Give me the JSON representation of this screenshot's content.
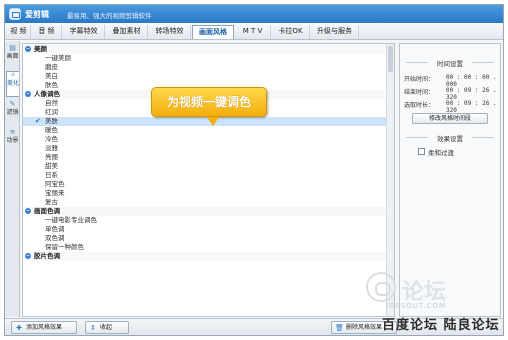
{
  "app": {
    "name": "爱剪辑",
    "slogan": "最易用、强大的视频剪辑软件"
  },
  "menu": {
    "tabs": [
      {
        "label": "视 频"
      },
      {
        "label": "音 频"
      },
      {
        "label": "字幕特效"
      },
      {
        "label": "叠加素材"
      },
      {
        "label": "转场特效"
      },
      {
        "label": "画面风格"
      },
      {
        "label": "M T V"
      },
      {
        "label": "卡拉OK"
      },
      {
        "label": "升级与服务"
      }
    ],
    "active": "画面风格"
  },
  "side_tabs": {
    "items": [
      {
        "label": "画面",
        "icon": "picture-icon"
      },
      {
        "label": "美化",
        "icon": "beautify-icon"
      },
      {
        "label": "滤镜",
        "icon": "filter-icon"
      },
      {
        "label": "动景",
        "icon": "motion-icon"
      }
    ],
    "active": "美化"
  },
  "style_list": {
    "rows": [
      {
        "kind": "group",
        "label": "美颜"
      },
      {
        "kind": "item",
        "label": "一键美颜"
      },
      {
        "kind": "item",
        "label": "磨皮"
      },
      {
        "kind": "item",
        "label": "美白"
      },
      {
        "kind": "item",
        "label": "肤色"
      },
      {
        "kind": "group",
        "label": "人像调色"
      },
      {
        "kind": "item",
        "label": "自然"
      },
      {
        "kind": "item",
        "label": "红润"
      },
      {
        "kind": "item",
        "label": "美肤",
        "selected": true,
        "checked": true
      },
      {
        "kind": "item",
        "label": "暖色"
      },
      {
        "kind": "item",
        "label": "冷色"
      },
      {
        "kind": "item",
        "label": "淡雅"
      },
      {
        "kind": "item",
        "label": "亮丽"
      },
      {
        "kind": "item",
        "label": "甜美"
      },
      {
        "kind": "item",
        "label": "日系"
      },
      {
        "kind": "item",
        "label": "阿宝色"
      },
      {
        "kind": "item",
        "label": "宝丽来"
      },
      {
        "kind": "item",
        "label": "复古"
      },
      {
        "kind": "group",
        "label": "画面色调"
      },
      {
        "kind": "item",
        "label": "一键电影专业调色"
      },
      {
        "kind": "item",
        "label": "单色调"
      },
      {
        "kind": "item",
        "label": "双色调"
      },
      {
        "kind": "item",
        "label": "保留一种颜色"
      },
      {
        "kind": "group",
        "label": "胶片色调"
      }
    ]
  },
  "callout": {
    "text": "为视频一键调色"
  },
  "time_settings": {
    "title": "时间设置",
    "start_label": "开始时间：",
    "start_value": "00 : 00 : 00 . 000",
    "end_label": "结束时间：",
    "end_value": "00 : 09 : 26 . 320",
    "duration_label": "选取时长：",
    "duration_value": "00 : 09 : 26 . 320",
    "modify_button": "修改风格时间段"
  },
  "effect_settings": {
    "title": "效果设置",
    "checkbox_label": "柔和过渡",
    "checkbox_checked": false
  },
  "bottom": {
    "add_button": "添加风格效果",
    "collapse_button": "收起",
    "delete_button": "删除风格效果"
  },
  "watermark": {
    "text_cn": "论坛",
    "url": "IDESOUT.COM",
    "site": "百度论坛 陆良论坛"
  },
  "colors": {
    "titlebar": "#2b78c6",
    "selection": "#cde3fa",
    "callout": "#f2ae0c"
  }
}
